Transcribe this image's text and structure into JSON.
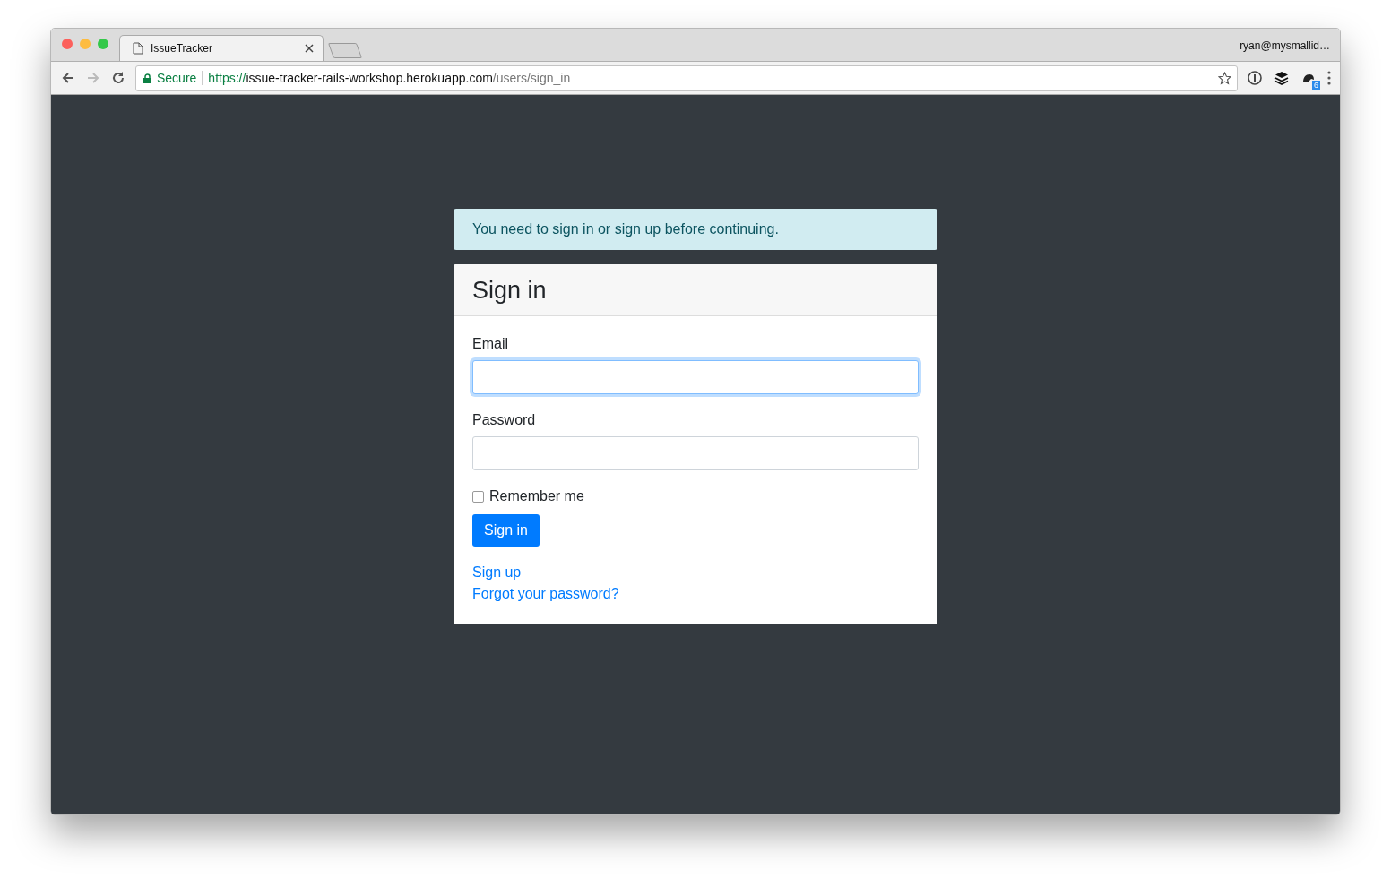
{
  "browser": {
    "tab": {
      "title": "IssueTracker",
      "selected": true
    },
    "profile": "ryan@mysmallid…",
    "address": {
      "security": "Secure",
      "scheme": "https://",
      "host": "issue-tracker-rails-workshop.herokuapp.com",
      "path": "/users/sign_in"
    },
    "extension_badge": "6"
  },
  "alert": {
    "message": "You need to sign in or sign up before continuing."
  },
  "card": {
    "title": "Sign in",
    "fields": [
      {
        "label": "Email",
        "focused": true
      },
      {
        "label": "Password",
        "focused": false
      }
    ],
    "remember": {
      "label": "Remember me",
      "checked": false
    },
    "submit": "Sign in",
    "links": [
      "Sign up",
      "Forgot your password?"
    ]
  }
}
